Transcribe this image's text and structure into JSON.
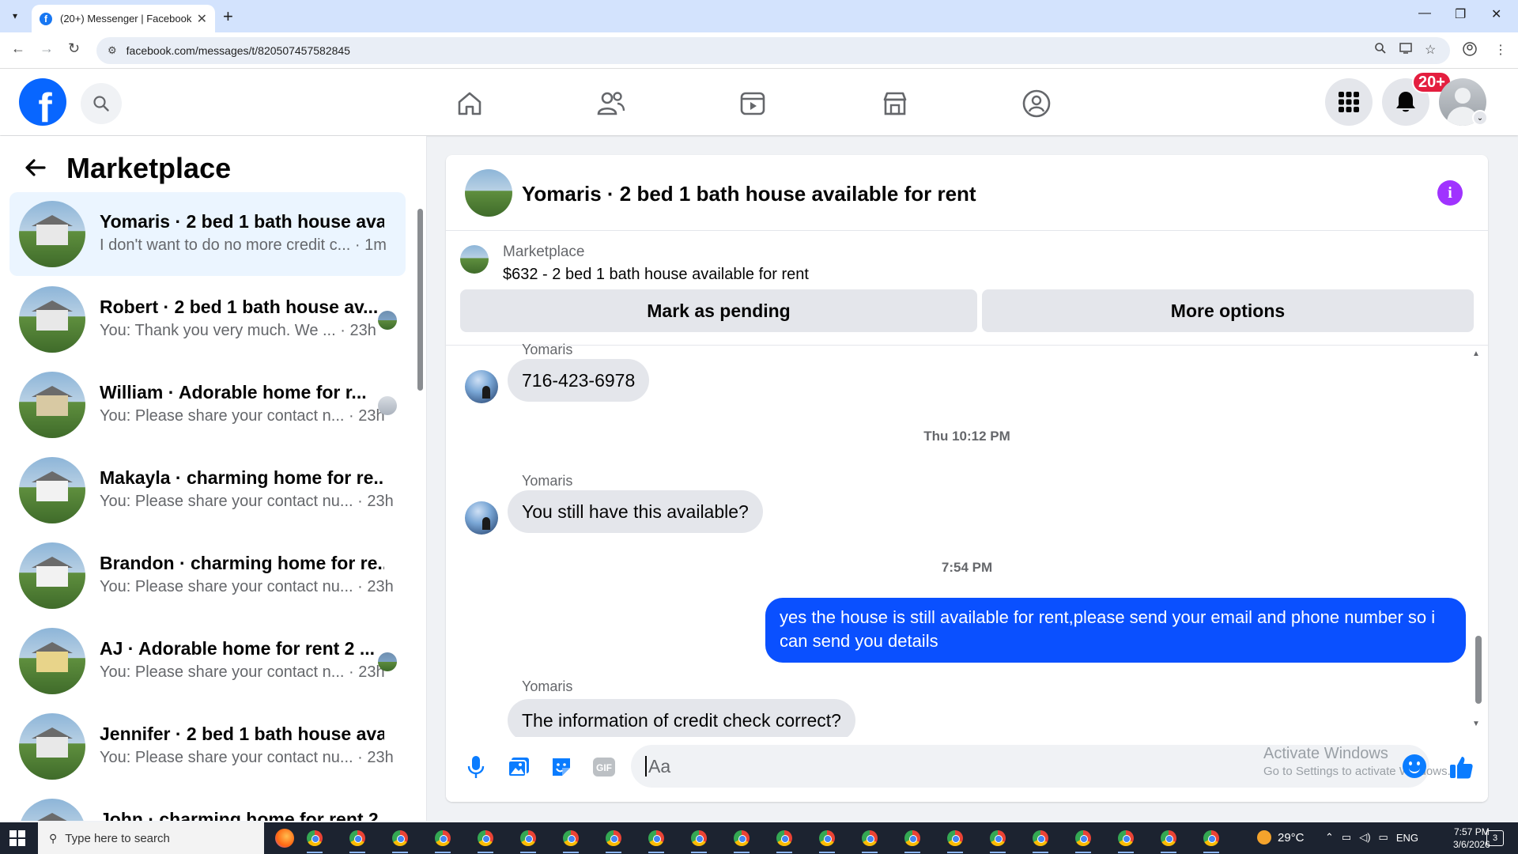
{
  "browser": {
    "tab_title": "(20+) Messenger | Facebook",
    "url": "facebook.com/messages/t/820507457582845"
  },
  "header": {
    "notification_badge": "20+"
  },
  "sidebar": {
    "title": "Marketplace",
    "conversations": [
      {
        "name": "Yomaris · 2 bed 1 bath house avai...",
        "preview": "I don't want to do no more credit c...",
        "time": "· 1m",
        "active": true
      },
      {
        "name": "Robert · 2 bed 1 bath house av...",
        "preview": "You: Thank you very much. We ...",
        "time": "· 23h"
      },
      {
        "name": "William · Adorable home for r...",
        "preview": "You: Please share your contact n...",
        "time": "· 23h"
      },
      {
        "name": "Makayla · charming home for re...",
        "preview": "You: Please share your contact nu...",
        "time": "· 23h"
      },
      {
        "name": "Brandon · charming home for re...",
        "preview": "You: Please share your contact nu...",
        "time": "· 23h"
      },
      {
        "name": "AJ · Adorable home for rent 2 ...",
        "preview": "You: Please share your contact n...",
        "time": "· 23h"
      },
      {
        "name": "Jennifer · 2 bed 1 bath house avai...",
        "preview": "You: Please share your contact nu...",
        "time": "· 23h"
      },
      {
        "name": "John · charming home for rent 2..."
      }
    ]
  },
  "chat": {
    "title": "Yomaris · 2 bed 1 bath house available for rent",
    "marketplace_label": "Marketplace",
    "listing": "$632 - 2 bed 1 bath house available for rent",
    "mark_pending_label": "Mark as pending",
    "more_options_label": "More options",
    "messages": {
      "sender_top": "Yomaris",
      "msg_phone": "716-423-6978",
      "time1": "Thu 10:12 PM",
      "sender2": "Yomaris",
      "msg_available": "You still have this available?",
      "time2": "7:54 PM",
      "msg_out": "yes the house is still available for rent,please send your email and phone number so i can send you details",
      "sender3": "Yomaris",
      "msg_credit": "The information of credit check correct?"
    },
    "composer": {
      "placeholder": "Aa",
      "watermark_line1": "Activate Windows",
      "watermark_line2": "Go to Settings to activate Windows."
    }
  },
  "taskbar": {
    "search_placeholder": "Type here to search",
    "temperature": "29°C",
    "language": "ENG",
    "time": "7:57 PM",
    "date": "3/6/2026",
    "notification_count": "3"
  },
  "colors": {
    "fb_blue": "#0866ff",
    "outgoing_bubble": "#0a50ff",
    "info_purple": "#a033ff",
    "badge_red": "#e41e3f"
  }
}
